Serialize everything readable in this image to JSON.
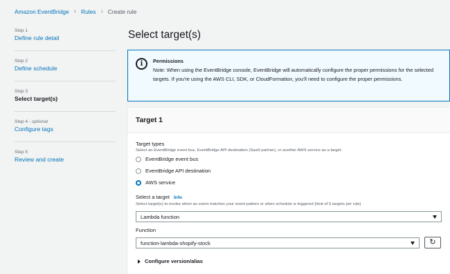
{
  "breadcrumb": {
    "items": [
      "Amazon EventBridge",
      "Rules",
      "Create rule"
    ]
  },
  "steps": [
    {
      "label": "Step 1",
      "optional": "",
      "title": "Define rule detail"
    },
    {
      "label": "Step 2",
      "optional": "",
      "title": "Define schedule"
    },
    {
      "label": "Step 3",
      "optional": "",
      "title": "Select target(s)"
    },
    {
      "label": "Step 4 - ",
      "optional": "optional",
      "title": "Configure tags"
    },
    {
      "label": "Step 5",
      "optional": "",
      "title": "Review and create"
    }
  ],
  "page_title": "Select target(s)",
  "permissions": {
    "title": "Permissions",
    "body": "Note: When using the EventBridge console, EventBridge will automatically configure the proper permissions for the selected targets. If you're using the AWS CLI, SDK, or CloudFormation, you'll need to configure the proper permissions."
  },
  "target": {
    "title": "Target 1",
    "types_label": "Target types",
    "types_desc": "Select an EventBridge event bus, EventBridge API destination (SaaS partner), or another AWS service as a target.",
    "options": [
      "EventBridge event bus",
      "EventBridge API destination",
      "AWS service"
    ],
    "selected_option": "AWS service",
    "select_label": "Select a target",
    "info_link": "Info",
    "select_desc": "Select target(s) to invoke when an event matches your event pattern or when schedule is triggered (limit of 5 targets per rule)",
    "select_value": "Lambda function",
    "function_label": "Function",
    "function_value": "function-lambda-shopify-stock",
    "configure_version": "Configure version/alias"
  },
  "icons": {
    "info": "info-circle-icon",
    "refresh": "refresh-icon",
    "caret": "caret-down-icon",
    "expand": "caret-right-icon"
  },
  "colors": {
    "link": "#0073bb",
    "info_bg": "#f1faff",
    "page_bg": "#f2f3f3"
  }
}
